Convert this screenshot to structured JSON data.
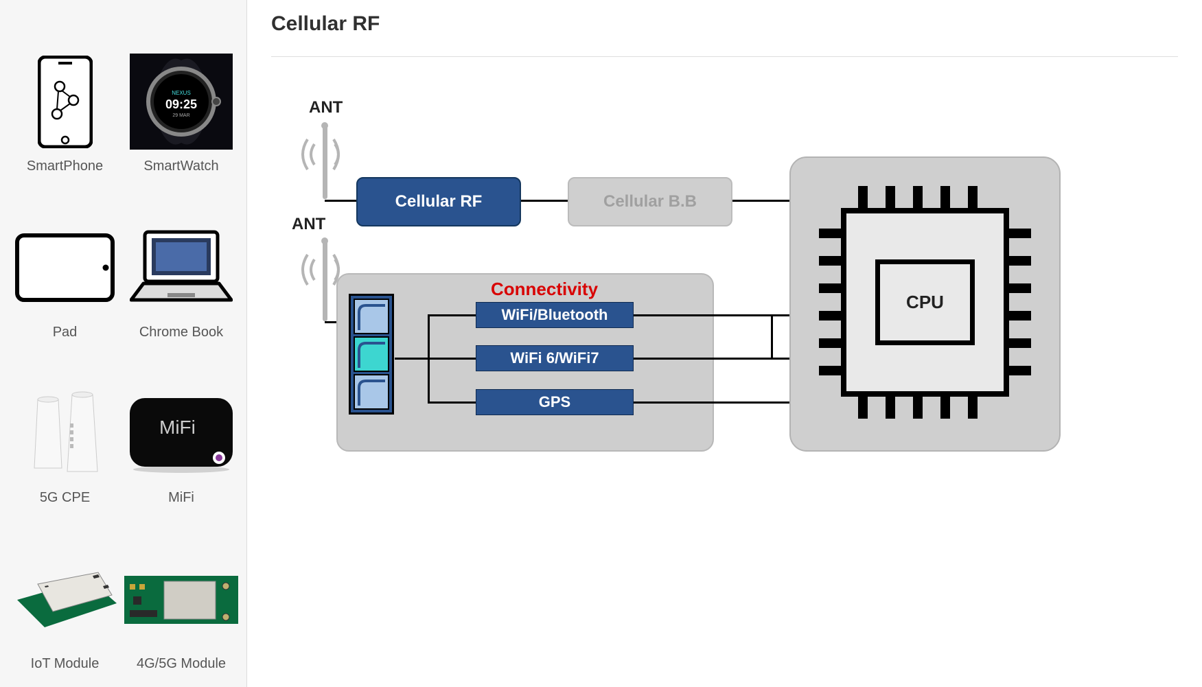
{
  "sidebar": {
    "items": [
      {
        "label": "SmartPhone"
      },
      {
        "label": "SmartWatch"
      },
      {
        "label": "Pad"
      },
      {
        "label": "Chrome Book"
      },
      {
        "label": "5G CPE"
      },
      {
        "label": "MiFi"
      },
      {
        "label": "IoT  Module"
      },
      {
        "label": "4G/5G Module"
      }
    ]
  },
  "main": {
    "title": "Cellular RF"
  },
  "diagram": {
    "ant1_label": "ANT",
    "ant2_label": "ANT",
    "cellular_rf": "Cellular RF",
    "cellular_bb": "Cellular B.B",
    "connectivity_title": "Connectivity",
    "conn_items": [
      "WiFi/Bluetooth",
      "WiFi 6/WiFi7",
      "GPS"
    ],
    "cpu_label": "CPU"
  }
}
